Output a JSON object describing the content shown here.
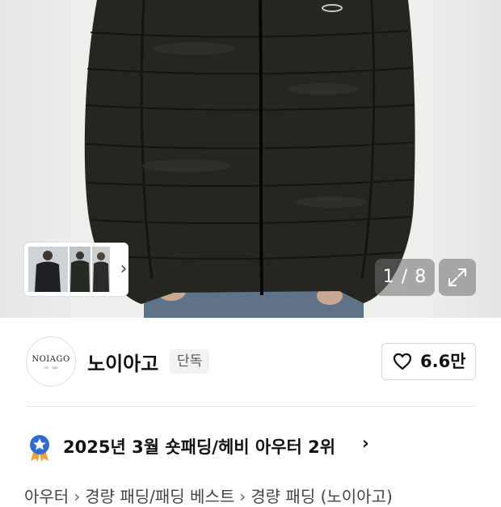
{
  "gallery": {
    "counter": "1 / 8",
    "thumbnail_count": 3
  },
  "brand": {
    "logo_text": "NOIAGO",
    "logo_subtext": "noi · ago",
    "name": "노이아고",
    "exclusive_badge": "단독",
    "likes": "6.6만"
  },
  "ranking": {
    "text": "2025년 3월 숏패딩/헤비 아우터 2위",
    "arrow": "›"
  },
  "breadcrumbs": {
    "c1": "아우터",
    "c2": "경량 패딩/패딩 베스트",
    "c3": "경량 패딩 (노이아고)",
    "sep": "›"
  },
  "colors": {
    "jacket": "#24261f",
    "jeans": "#5e7387",
    "badge_blue": "#2f6bd3",
    "badge_orange": "#f0a23a"
  },
  "icons": {
    "expand": "expand-icon",
    "heart": "heart-icon",
    "rank": "ranking-medal-icon"
  }
}
